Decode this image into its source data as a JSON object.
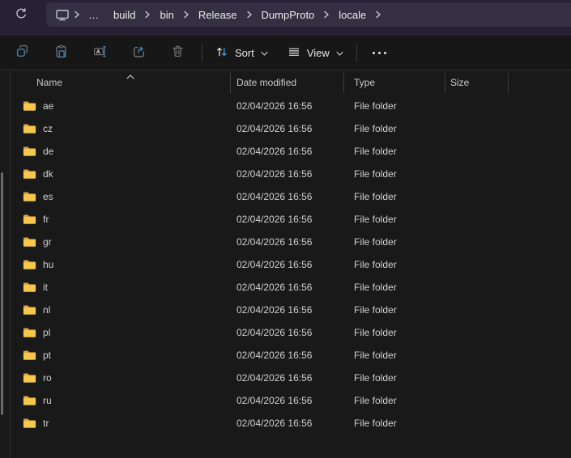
{
  "colors": {
    "topbar_bg": "#282136",
    "address_field_bg": "#352f44",
    "toolbar_bg": "#171717",
    "list_bg": "#191919",
    "accent_blue": "#4580B4",
    "sort_arrow_blue": "#3FA1E3",
    "folder_front": "#F5C84C",
    "folder_back": "#E0A23C"
  },
  "address_bar": {
    "overflow": "…",
    "crumbs": [
      "build",
      "bin",
      "Release",
      "DumpProto",
      "locale"
    ]
  },
  "toolbar": {
    "icon_buttons": [
      {
        "name": "copy"
      },
      {
        "name": "paste"
      },
      {
        "name": "rename"
      },
      {
        "name": "share"
      },
      {
        "name": "delete"
      }
    ],
    "sort_label": "Sort",
    "view_label": "View"
  },
  "columns": [
    {
      "label": "Name",
      "sorted": "ascending"
    },
    {
      "label": "Date modified"
    },
    {
      "label": "Type"
    },
    {
      "label": "Size"
    }
  ],
  "rows": [
    {
      "name": "ae",
      "date_modified": "02/04/2026 16:56",
      "type": "File folder",
      "size": ""
    },
    {
      "name": "cz",
      "date_modified": "02/04/2026 16:56",
      "type": "File folder",
      "size": ""
    },
    {
      "name": "de",
      "date_modified": "02/04/2026 16:56",
      "type": "File folder",
      "size": ""
    },
    {
      "name": "dk",
      "date_modified": "02/04/2026 16:56",
      "type": "File folder",
      "size": ""
    },
    {
      "name": "es",
      "date_modified": "02/04/2026 16:56",
      "type": "File folder",
      "size": ""
    },
    {
      "name": "fr",
      "date_modified": "02/04/2026 16:56",
      "type": "File folder",
      "size": ""
    },
    {
      "name": "gr",
      "date_modified": "02/04/2026 16:56",
      "type": "File folder",
      "size": ""
    },
    {
      "name": "hu",
      "date_modified": "02/04/2026 16:56",
      "type": "File folder",
      "size": ""
    },
    {
      "name": "it",
      "date_modified": "02/04/2026 16:56",
      "type": "File folder",
      "size": ""
    },
    {
      "name": "nl",
      "date_modified": "02/04/2026 16:56",
      "type": "File folder",
      "size": ""
    },
    {
      "name": "pl",
      "date_modified": "02/04/2026 16:56",
      "type": "File folder",
      "size": ""
    },
    {
      "name": "pt",
      "date_modified": "02/04/2026 16:56",
      "type": "File folder",
      "size": ""
    },
    {
      "name": "ro",
      "date_modified": "02/04/2026 16:56",
      "type": "File folder",
      "size": ""
    },
    {
      "name": "ru",
      "date_modified": "02/04/2026 16:56",
      "type": "File folder",
      "size": ""
    },
    {
      "name": "tr",
      "date_modified": "02/04/2026 16:56",
      "type": "File folder",
      "size": ""
    }
  ]
}
